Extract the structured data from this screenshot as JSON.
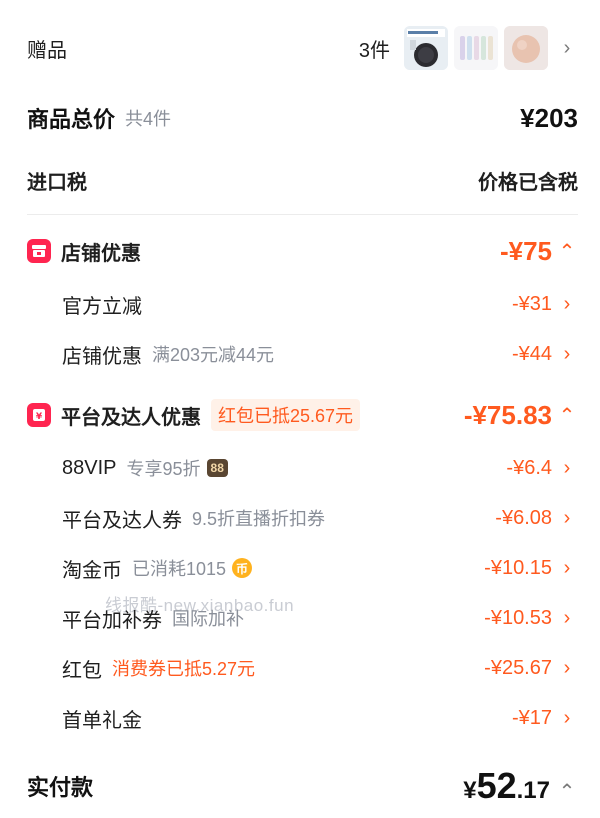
{
  "gift": {
    "label": "赠品",
    "count": "3件"
  },
  "total": {
    "label": "商品总价",
    "count": "共4件",
    "amount": "¥203"
  },
  "tax": {
    "label": "进口税",
    "value": "价格已含税"
  },
  "store_section": {
    "title": "店铺优惠",
    "amount": "-¥75",
    "items": [
      {
        "label": "官方立减",
        "detail": "",
        "amount": "-¥31"
      },
      {
        "label": "店铺优惠",
        "detail": "满203元减44元",
        "amount": "-¥44"
      }
    ]
  },
  "platform_section": {
    "title": "平台及达人优惠",
    "badge": "红包已抵25.67元",
    "amount": "-¥75.83",
    "items": {
      "vip": {
        "label": "88VIP",
        "detail": "专享95折",
        "badge": "88",
        "amount": "-¥6.4"
      },
      "coupon": {
        "label": "平台及达人券",
        "detail": "9.5折直播折扣券",
        "amount": "-¥6.08"
      },
      "coin": {
        "label": "淘金币",
        "detail": "已消耗1015",
        "coin_symbol": "币",
        "amount": "-¥10.15"
      },
      "subsidy": {
        "label": "平台加补券",
        "detail": "国际加补",
        "amount": "-¥10.53"
      },
      "redpacket": {
        "label": "红包",
        "detail": "消费券已抵5.27元",
        "amount": "-¥25.67"
      },
      "firstorder": {
        "label": "首单礼金",
        "detail": "",
        "amount": "-¥17"
      }
    }
  },
  "payment": {
    "label": "实付款",
    "currency": "¥",
    "integer": "52",
    "decimal": ".17"
  },
  "watermark": "线报酷-new.xianbao.fun",
  "colors": {
    "accent": "#ff5a1f",
    "section_icon": "#ff2550"
  }
}
